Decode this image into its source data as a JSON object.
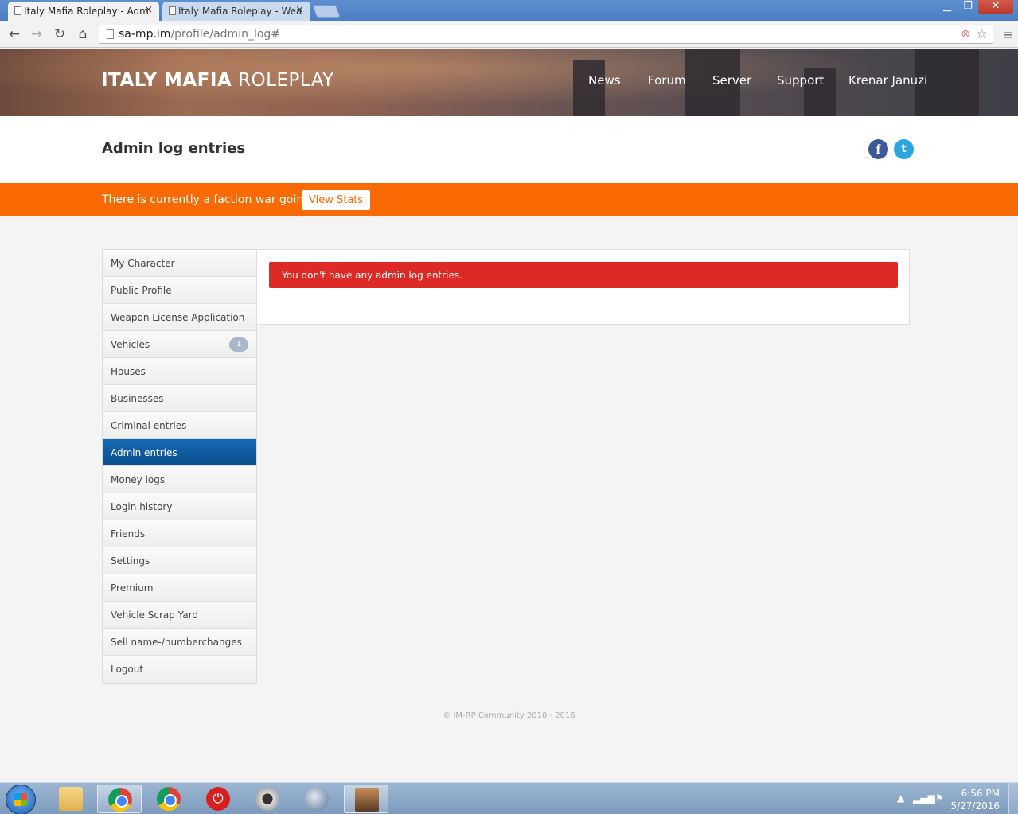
{
  "browser": {
    "tabs": [
      {
        "label": "Italy Mafia Roleplay - Adm",
        "active": true
      },
      {
        "label": "Italy Mafia Roleplay - Wea",
        "active": false
      }
    ],
    "close_glyph": "×",
    "url_host": "sa-mp.im",
    "url_path": "/profile/admin_log#",
    "window_buttons": {
      "minimize": "▁",
      "maximize": "❐",
      "close": "✕"
    }
  },
  "site": {
    "logo_bold": "ITALY MAFIA",
    "logo_light": "ROLEPLAY",
    "nav": [
      "News",
      "Forum",
      "Server",
      "Support",
      "Krenar Januzi"
    ]
  },
  "page": {
    "title": "Admin log entries",
    "social": {
      "facebook": "f",
      "twitter": "t"
    }
  },
  "alert": {
    "text": "There is currently a faction war going on!",
    "button": "View Stats"
  },
  "sidebar": {
    "items": [
      {
        "label": "My Character"
      },
      {
        "label": "Public Profile"
      },
      {
        "label": "Weapon License Application"
      },
      {
        "label": "Vehicles",
        "badge": "1"
      },
      {
        "label": "Houses"
      },
      {
        "label": "Businesses"
      },
      {
        "label": "Criminal entries"
      },
      {
        "label": "Admin entries",
        "active": true
      },
      {
        "label": "Money logs"
      },
      {
        "label": "Login history"
      },
      {
        "label": "Friends"
      },
      {
        "label": "Settings"
      },
      {
        "label": "Premium"
      },
      {
        "label": "Vehicle Scrap Yard"
      },
      {
        "label": "Sell name-/numberchanges"
      },
      {
        "label": "Logout"
      }
    ]
  },
  "main": {
    "error_message": "You don't have any admin log entries."
  },
  "footer": {
    "copyright": "© IM-RP Community 2010 - 2016"
  },
  "taskbar": {
    "time": "6:56 PM",
    "date": "5/27/2016"
  },
  "colors": {
    "accent_orange": "#f96a05",
    "active_blue": "#0b4f8e",
    "error_red": "#de2a26"
  }
}
